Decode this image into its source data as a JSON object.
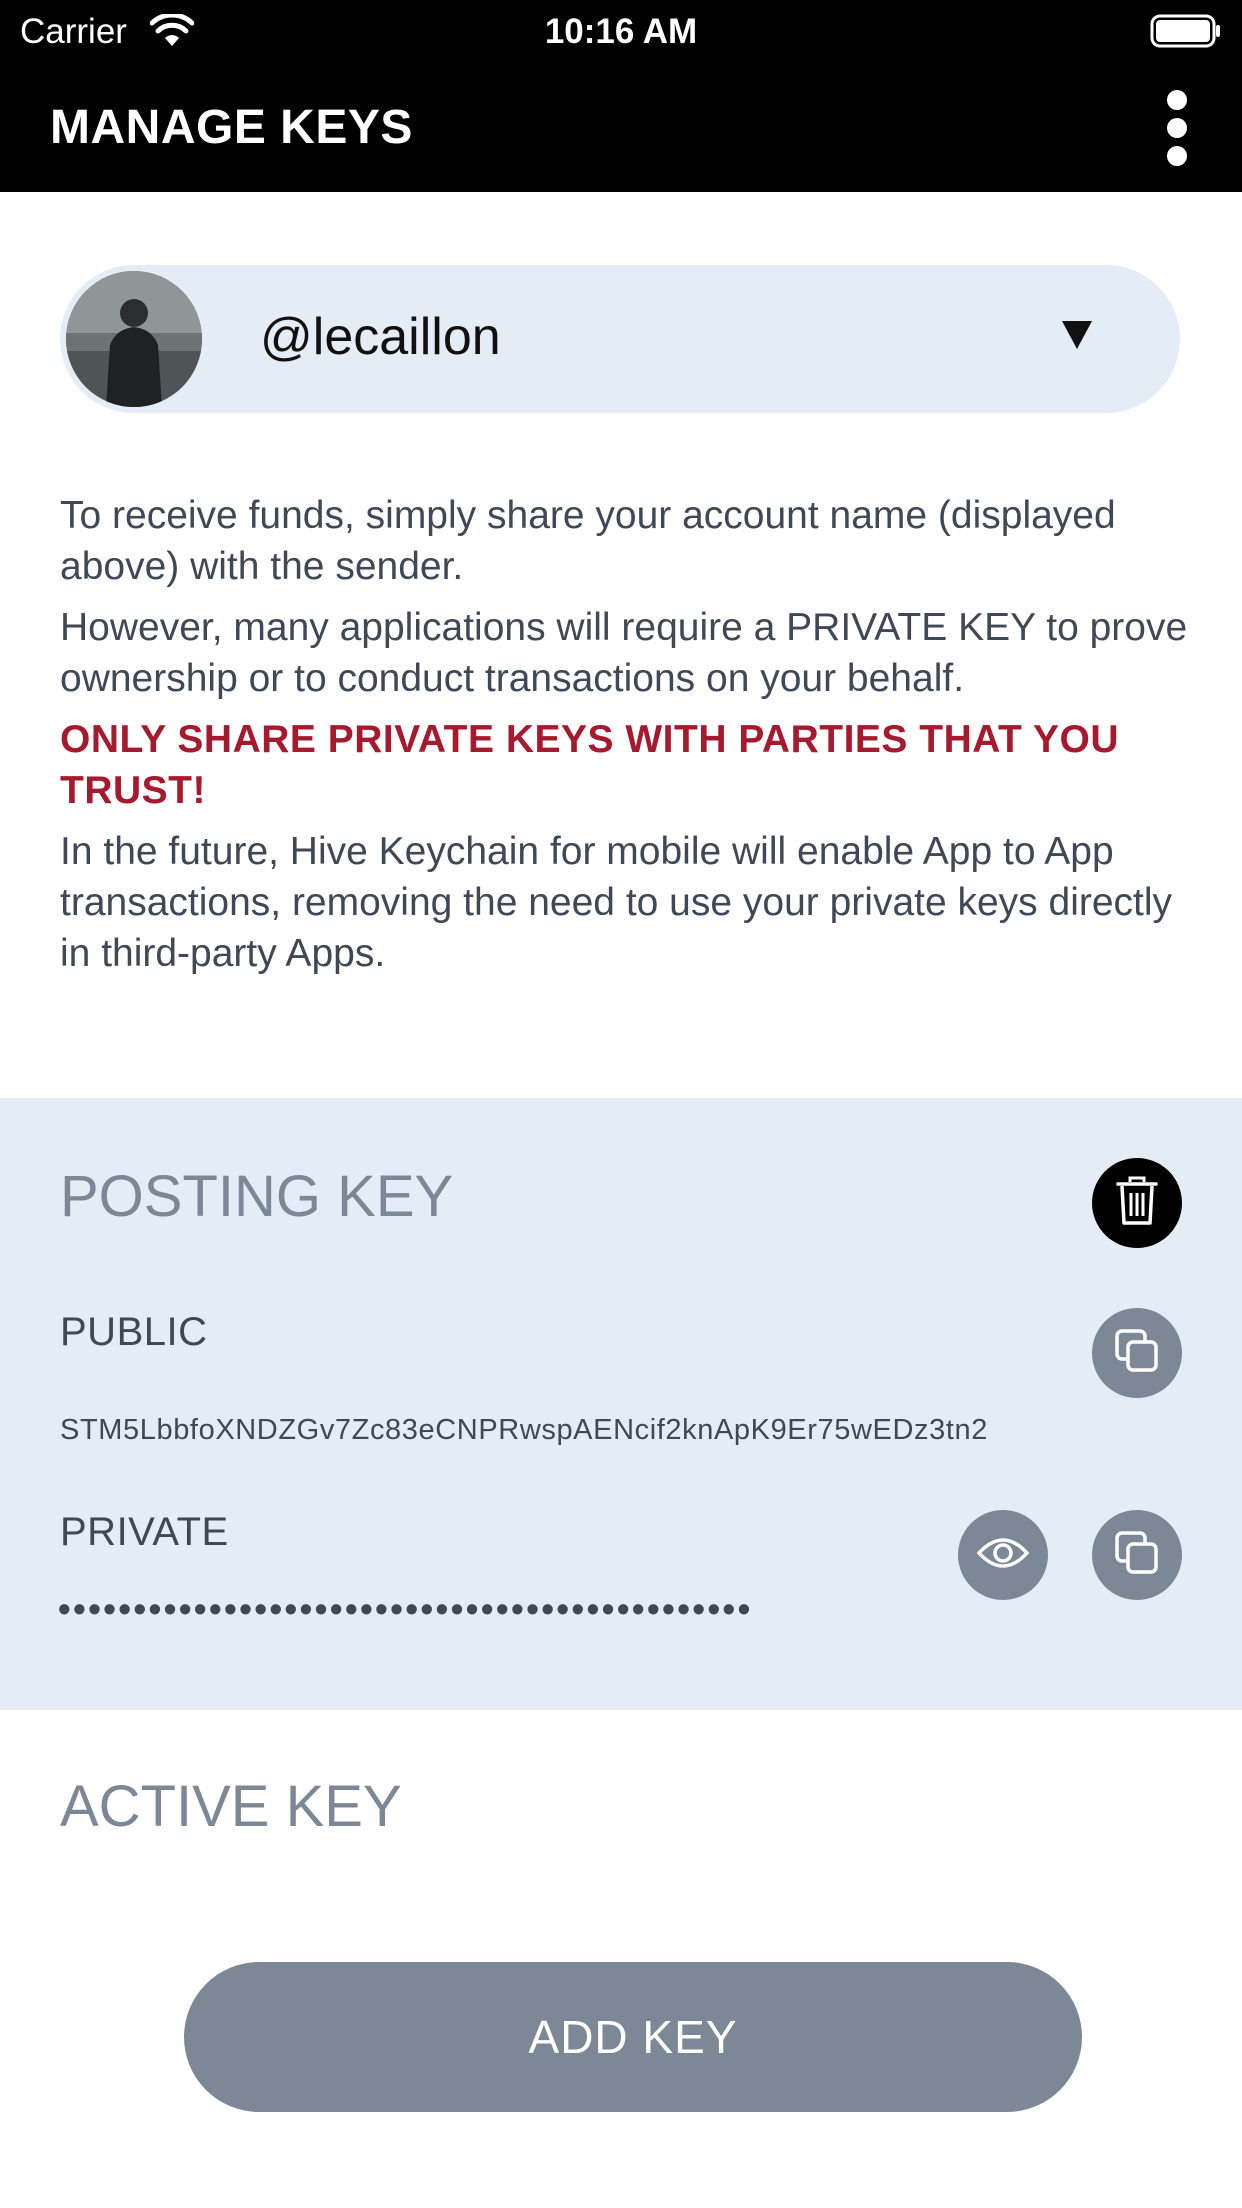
{
  "status_bar": {
    "carrier": "Carrier",
    "time": "10:16 AM"
  },
  "header": {
    "title": "MANAGE KEYS"
  },
  "account": {
    "name": "@lecaillon"
  },
  "info": {
    "paragraph1": "To receive funds, simply share your account name (displayed above) with the sender.",
    "paragraph2": "However, many applications will require a PRIVATE KEY to prove ownership or to conduct transactions on your behalf.",
    "warning": "ONLY SHARE PRIVATE KEYS WITH PARTIES THAT YOU TRUST!",
    "paragraph3": "In the future, Hive Keychain for mobile will enable App to App transactions, removing the need to use your private keys directly in third-party Apps."
  },
  "posting_key": {
    "title": "POSTING KEY",
    "public_label": "PUBLIC",
    "public_value": "STM5LbbfoXNDZGv7Zc83eCNPRwspAENcif2knApK9Er75wEDz3tn2",
    "private_label": "PRIVATE",
    "private_value": "••••••••••••••••••••••••••••••••••••••••••••••"
  },
  "active_key": {
    "title": "ACTIVE KEY"
  },
  "add_key": {
    "label": "ADD KEY"
  },
  "colors": {
    "header_bg": "#000000",
    "section_bg": "#e4ecf6",
    "muted": "#7d8896",
    "warning": "#a51a2e",
    "text": "#404856"
  },
  "icons": {
    "menu": "more-vertical-icon",
    "dropdown": "caret-down-icon",
    "delete": "trash-icon",
    "copy": "copy-icon",
    "reveal": "eye-icon",
    "wifi": "wifi-icon",
    "battery": "battery-icon"
  }
}
